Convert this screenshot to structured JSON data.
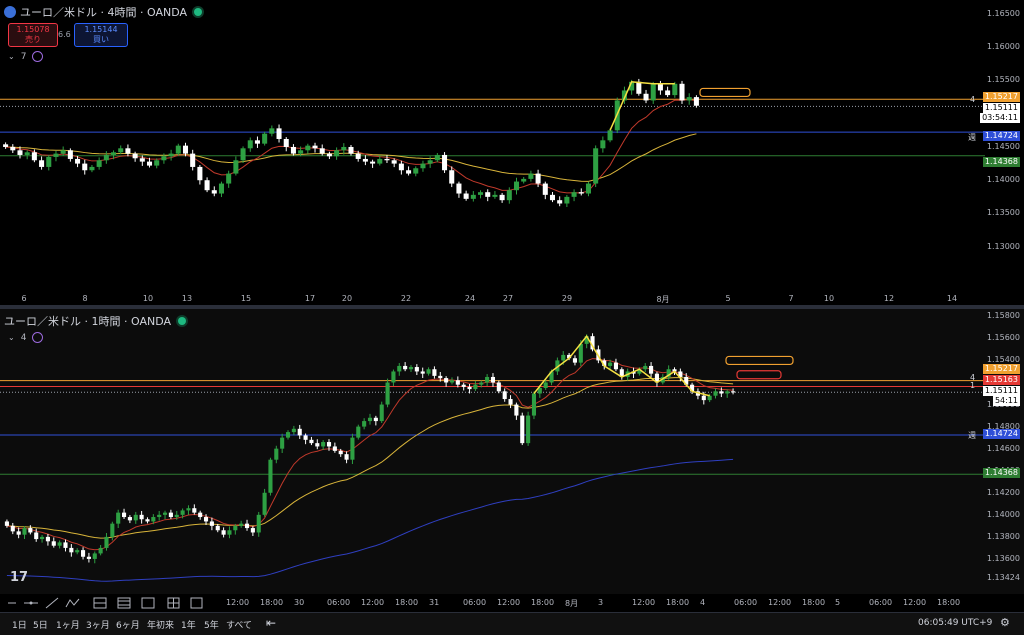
{
  "pane1": {
    "title": "ユーロ／米ドル · 4時間 · OANDA",
    "sell_price": "1.15078",
    "sell_label": "売り",
    "spread": "6.6",
    "buy_price": "1.15144",
    "buy_label": "買い",
    "indicator_count": "7",
    "y_ticks": [
      "1.16500",
      "1.16000",
      "1.15500",
      "1.15000",
      "1.14500",
      "1.14000",
      "1.13500",
      "1.13000"
    ],
    "x_labels": [
      "6",
      "8",
      "10",
      "13",
      "15",
      "17",
      "20",
      "22",
      "24",
      "27",
      "29",
      "8月",
      "5",
      "7",
      "10",
      "12",
      "14"
    ],
    "level_labels": {
      "l4": "4",
      "weekly": "週"
    },
    "badges": {
      "orange": "1.15217",
      "current": "1.15111",
      "timer": "03:54:11",
      "blue": "1.14724",
      "green": "1.14368"
    }
  },
  "pane2": {
    "title": "ユーロ／米ドル · 1時間 · OANDA",
    "indicator_count": "4",
    "y_ticks": [
      "1.15800",
      "1.15600",
      "1.15400",
      "1.15200",
      "1.15000",
      "1.14800",
      "1.14600",
      "1.14400",
      "1.14200",
      "1.14000",
      "1.13800",
      "1.13600",
      "1.13424"
    ],
    "x_labels": [
      "12:00",
      "18:00",
      "30",
      "06:00",
      "12:00",
      "18:00",
      "31",
      "06:00",
      "12:00",
      "18:00",
      "8月",
      "3",
      "12:00",
      "18:00",
      "4",
      "06:00",
      "12:00",
      "18:00",
      "5",
      "06:00",
      "12:00",
      "18:00"
    ],
    "level_labels": {
      "l4": "4",
      "l1": "1",
      "weekly": "週"
    },
    "badges": {
      "orange": "1.15217",
      "red": "1.15163",
      "current": "1.15111",
      "timer": "54:11",
      "blue": "1.14724",
      "green": "1.14368"
    }
  },
  "bottom_bar": {
    "ranges": [
      "1日",
      "5日",
      "1ヶ月",
      "3ヶ月",
      "6ヶ月",
      "年初来",
      "1年",
      "5年",
      "すべて"
    ],
    "clock": "06:05:49 UTC+9"
  },
  "colors": {
    "up": "#2ea043",
    "down": "#ffffff",
    "orange_level": "#f0a030",
    "blue_level": "#2f4fd8",
    "green_level": "#2e7d32",
    "red_level": "#e53935",
    "ma_yellow": "#d8b43a",
    "ma_red": "#c0392b",
    "ma_blue": "#2f3fc0",
    "zigzag": "#f5e042"
  },
  "chart_data": [
    {
      "type": "candlestick",
      "title": "ユーロ／米ドル · 4時間 · OANDA",
      "ylim": [
        1.1265,
        1.1665
      ],
      "y_ticks": [
        1.165,
        1.16,
        1.155,
        1.15,
        1.145,
        1.14,
        1.135,
        1.13
      ],
      "closes": [
        1.145,
        1.1445,
        1.1438,
        1.1442,
        1.143,
        1.142,
        1.1435,
        1.144,
        1.1445,
        1.1432,
        1.1425,
        1.1415,
        1.142,
        1.143,
        1.1438,
        1.1442,
        1.1448,
        1.144,
        1.1433,
        1.1428,
        1.1422,
        1.143,
        1.1436,
        1.144,
        1.1452,
        1.144,
        1.142,
        1.14,
        1.1385,
        1.138,
        1.1395,
        1.141,
        1.143,
        1.1448,
        1.146,
        1.1455,
        1.147,
        1.1478,
        1.1462,
        1.145,
        1.144,
        1.1445,
        1.1452,
        1.1448,
        1.144,
        1.1436,
        1.1445,
        1.145,
        1.144,
        1.1432,
        1.1428,
        1.1425,
        1.1432,
        1.143,
        1.1425,
        1.1415,
        1.141,
        1.1418,
        1.1425,
        1.143,
        1.1438,
        1.1415,
        1.1395,
        1.138,
        1.1372,
        1.1378,
        1.1382,
        1.1375,
        1.1378,
        1.137,
        1.1385,
        1.1398,
        1.1402,
        1.141,
        1.1395,
        1.1378,
        1.137,
        1.1365,
        1.1375,
        1.1382,
        1.138,
        1.1395,
        1.1448,
        1.146,
        1.1475,
        1.152,
        1.1535,
        1.1548,
        1.153,
        1.152,
        1.1545,
        1.1535,
        1.1528,
        1.1545,
        1.152,
        1.1525,
        1.1512
      ],
      "ma_fast_color": "red",
      "ma_slow_color": "yellow",
      "horizontal_levels": {
        "1.15217": "orange",
        "1.15111": "current (dotted)",
        "1.14724": "blue",
        "1.14368": "green"
      }
    },
    {
      "type": "candlestick",
      "title": "ユーロ／米ドル · 1時間 · OANDA",
      "ylim": [
        1.134,
        1.1583
      ],
      "y_ticks": [
        1.158,
        1.156,
        1.154,
        1.152,
        1.15,
        1.148,
        1.146,
        1.144,
        1.142,
        1.14,
        1.138,
        1.136,
        1.13424
      ],
      "closes": [
        1.139,
        1.1385,
        1.1382,
        1.1388,
        1.1384,
        1.1378,
        1.138,
        1.1376,
        1.1372,
        1.1375,
        1.137,
        1.1366,
        1.1368,
        1.1362,
        1.136,
        1.1365,
        1.137,
        1.138,
        1.1392,
        1.1402,
        1.1398,
        1.1395,
        1.14,
        1.1396,
        1.1394,
        1.1398,
        1.14,
        1.1402,
        1.1398,
        1.14,
        1.1404,
        1.1406,
        1.1402,
        1.1398,
        1.1394,
        1.139,
        1.1386,
        1.1382,
        1.1386,
        1.139,
        1.1392,
        1.1388,
        1.1384,
        1.14,
        1.142,
        1.145,
        1.146,
        1.147,
        1.1475,
        1.1478,
        1.1472,
        1.1468,
        1.1465,
        1.1462,
        1.1466,
        1.1462,
        1.1458,
        1.1455,
        1.145,
        1.147,
        1.148,
        1.1485,
        1.1488,
        1.1485,
        1.15,
        1.152,
        1.153,
        1.1535,
        1.1532,
        1.1534,
        1.153,
        1.1528,
        1.1532,
        1.1526,
        1.1524,
        1.152,
        1.1522,
        1.1518,
        1.1516,
        1.1514,
        1.1518,
        1.152,
        1.1525,
        1.152,
        1.1512,
        1.1505,
        1.15,
        1.149,
        1.1465,
        1.149,
        1.151,
        1.1515,
        1.152,
        1.153,
        1.154,
        1.1545,
        1.1542,
        1.1538,
        1.1555,
        1.1562,
        1.155,
        1.154,
        1.1535,
        1.1538,
        1.1532,
        1.1525,
        1.153,
        1.1528,
        1.1532,
        1.1535,
        1.1528,
        1.152,
        1.1525,
        1.1532,
        1.153,
        1.1525,
        1.1518,
        1.1512,
        1.1508,
        1.1504,
        1.1508,
        1.1512,
        1.151,
        1.1512,
        1.1511
      ],
      "ma_fast_color": "red",
      "ma_slow_color": "yellow",
      "ma_long_color": "blue",
      "horizontal_levels": {
        "1.15217": "orange",
        "1.15163": "red",
        "1.15111": "current (dotted)",
        "1.14724": "blue",
        "1.14368": "green"
      }
    }
  ]
}
